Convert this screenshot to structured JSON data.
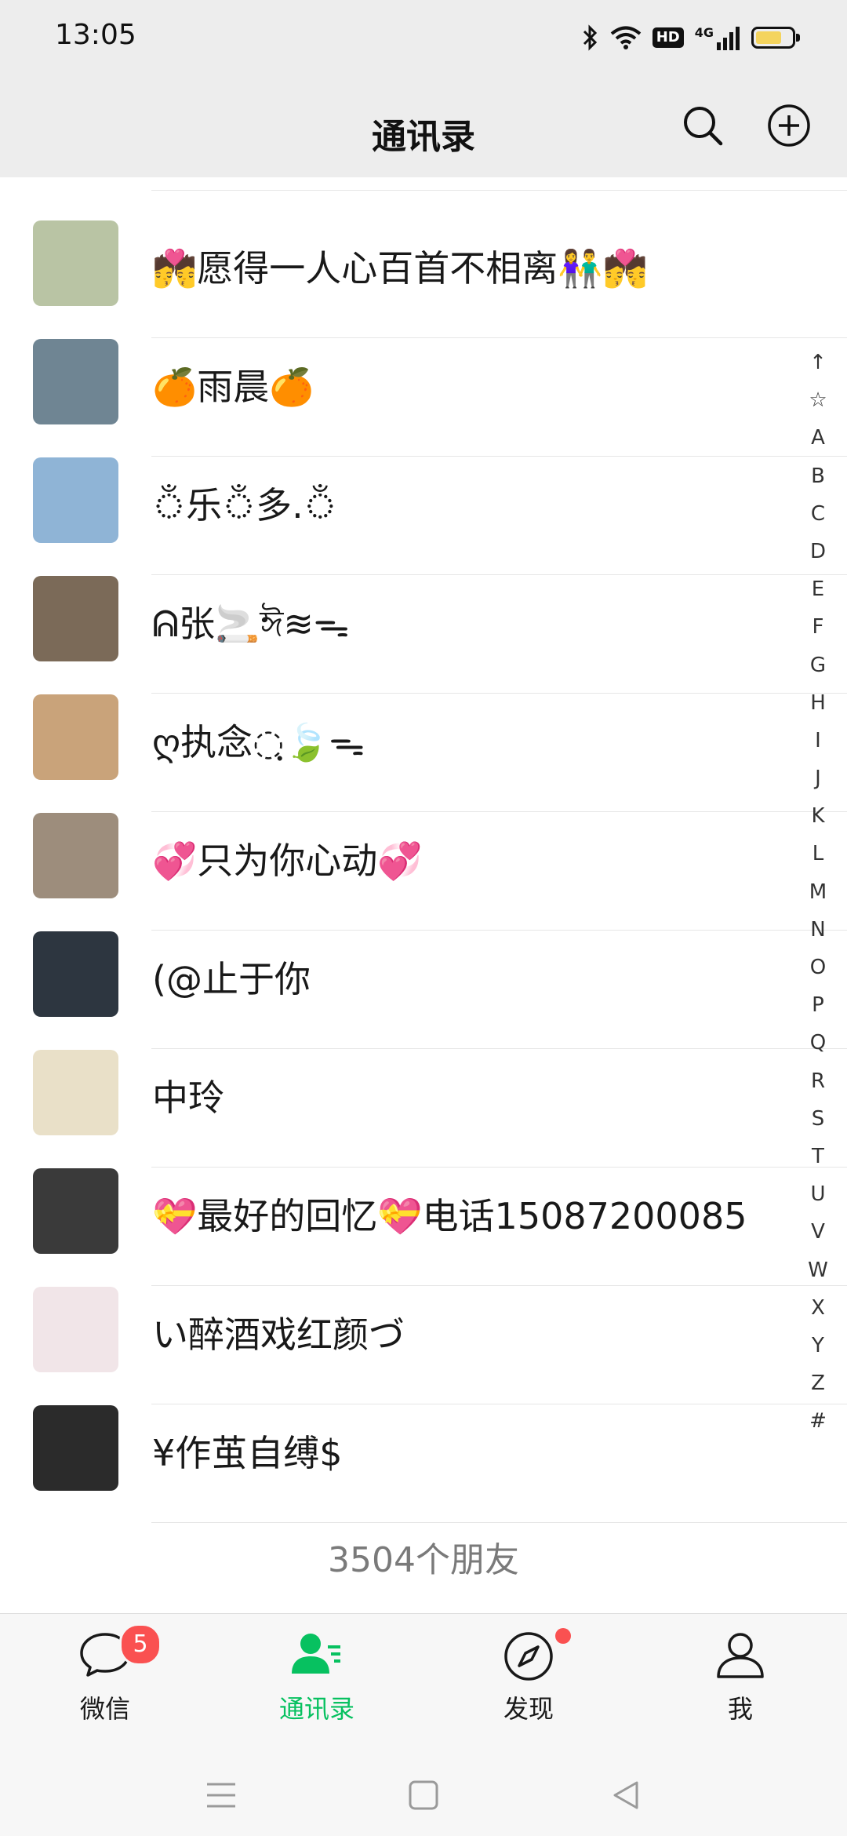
{
  "status_bar": {
    "time": "13:05",
    "hd": "HD",
    "network": "4G",
    "battery_level": 0.75
  },
  "header": {
    "title": "通讯录",
    "search_icon": "search-icon",
    "add_icon": "plus-circle-icon"
  },
  "contacts": [
    {
      "name": "💏愿得一人心百首不相离👫💏",
      "avatar_color": "#b9c4a4"
    },
    {
      "name": "🍊雨晨🍊",
      "avatar_color": "#6f8593"
    },
    {
      "name": "ঁ乐ঁ多.ঁ",
      "avatar_color": "#8fb4d6"
    },
    {
      "name": "ᕱ张🚬ঈ≋ᯓ",
      "avatar_color": "#7b6a58"
    },
    {
      "name": "ღ执念◌ฺ🍃ᯓ",
      "avatar_color": "#c9a37a"
    },
    {
      "name": "💞只为你心动💞",
      "avatar_color": "#9d8d7c"
    },
    {
      "name": "(@止于你",
      "avatar_color": "#2d3640"
    },
    {
      "name": "中玲",
      "avatar_color": "#e9e0c8"
    },
    {
      "name": "💝最好的回忆💝电话15087200085",
      "avatar_color": "#3a3a3a"
    },
    {
      "name": "い醉酒戏红颜づ",
      "avatar_color": "#f1e5e8"
    },
    {
      "name": "¥作茧自缚$",
      "avatar_color": "#2b2b2b"
    }
  ],
  "friend_count": "3504个朋友",
  "alpha_index": [
    "↑",
    "☆",
    "A",
    "B",
    "C",
    "D",
    "E",
    "F",
    "G",
    "H",
    "I",
    "J",
    "K",
    "L",
    "M",
    "N",
    "O",
    "P",
    "Q",
    "R",
    "S",
    "T",
    "U",
    "V",
    "W",
    "X",
    "Y",
    "Z",
    "#"
  ],
  "tabs": [
    {
      "label": "微信",
      "icon": "chat-bubble-icon",
      "badge": "5"
    },
    {
      "label": "通讯录",
      "icon": "contacts-icon",
      "active": true
    },
    {
      "label": "发现",
      "icon": "compass-icon",
      "dot": true
    },
    {
      "label": "我",
      "icon": "person-icon"
    }
  ],
  "colors": {
    "accent": "#07c160",
    "badge": "#fa5151"
  }
}
